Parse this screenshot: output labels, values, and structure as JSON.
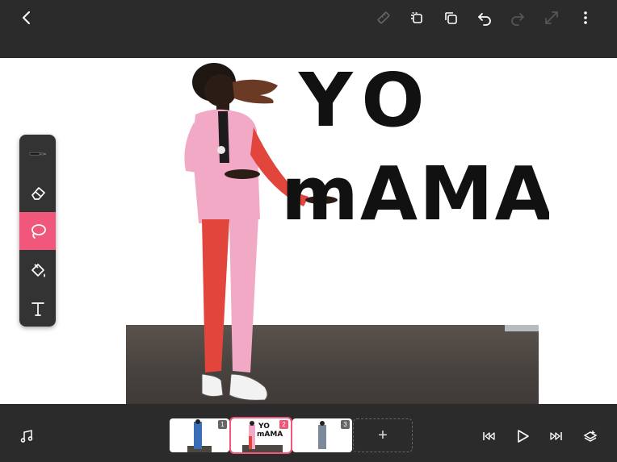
{
  "canvas_text": {
    "line1": "YO",
    "line2": "mAMA"
  },
  "timeline": {
    "frames": [
      {
        "number": "1"
      },
      {
        "number": "2"
      },
      {
        "number": "3"
      }
    ],
    "add_frame_label": "+",
    "active_frame": 2
  },
  "toolbar": {
    "tools": [
      "pen-tool",
      "eraser-tool",
      "lasso-tool",
      "fill-tool",
      "text-tool"
    ],
    "active_tool": "lasso-tool"
  },
  "colors": {
    "accent": "#f0577b",
    "bar": "#2b2b2b",
    "panel": "#333333"
  }
}
